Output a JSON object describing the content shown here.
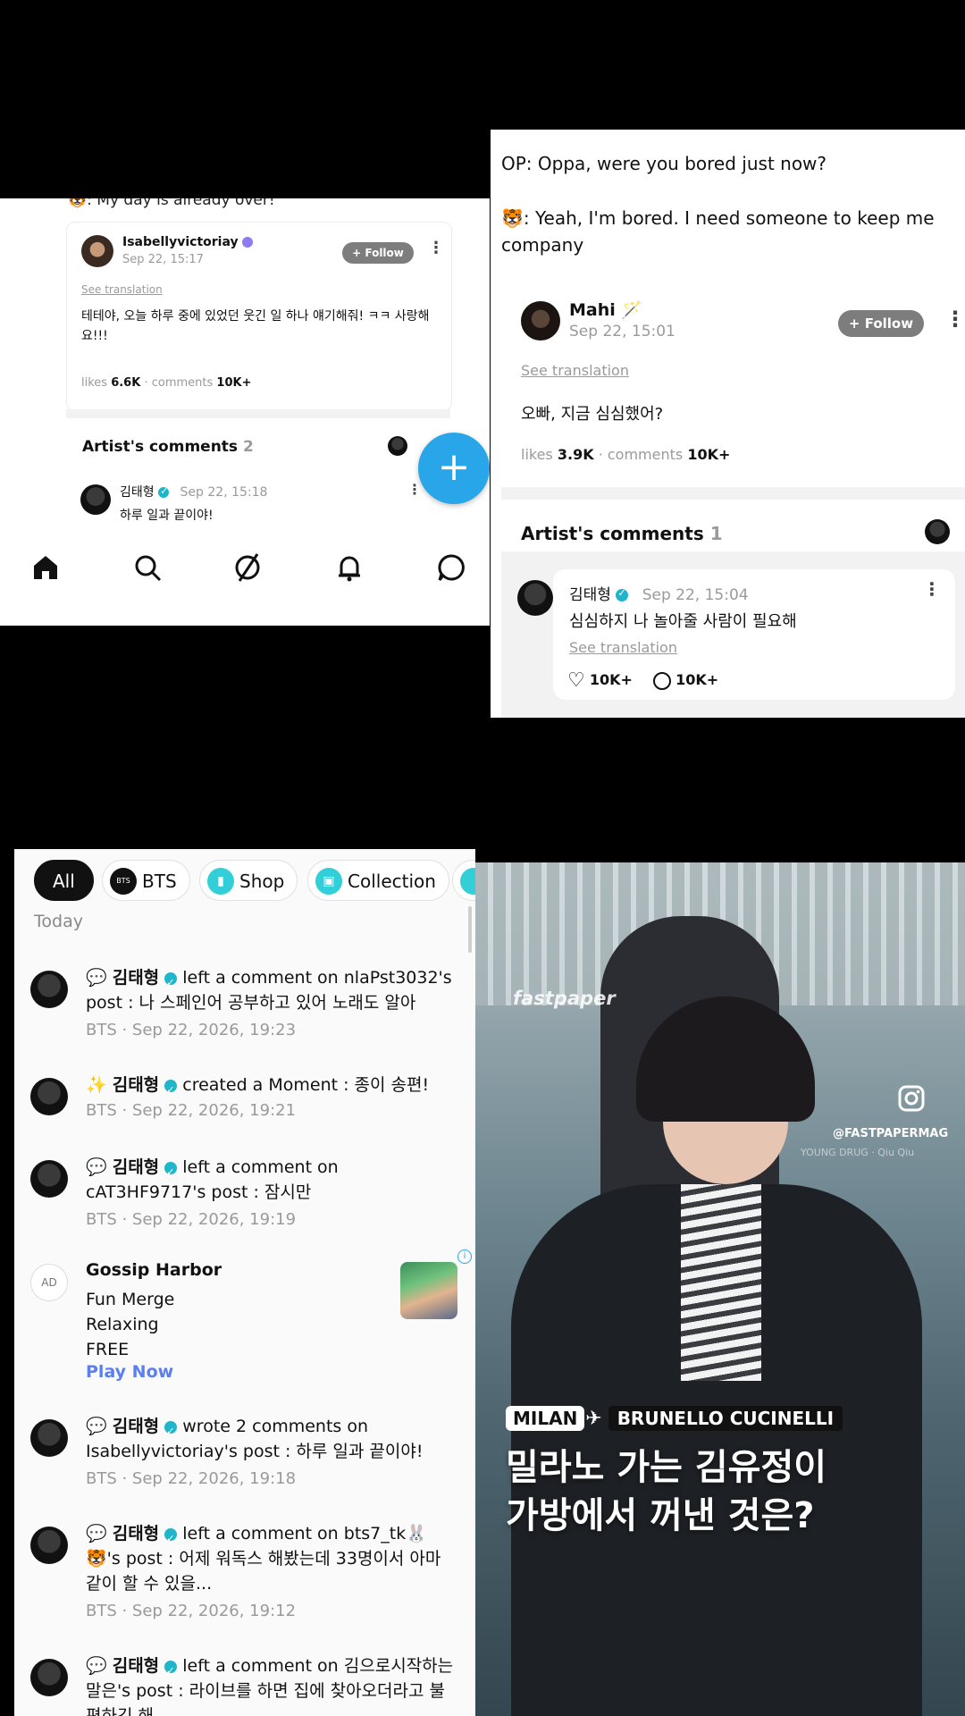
{
  "panel1": {
    "top_line": "🐯: My day is already over!",
    "post": {
      "author": "Isabellyvictoriay",
      "time": "Sep 22, 15:17",
      "follow": "+ Follow",
      "see_translation": "See translation",
      "body": "테테야, 오늘 하루 중에 있었던 웃긴 일 하나 얘기해줘! ㅋㅋ 사랑해요!!!",
      "likes_label": "likes",
      "likes": "6.6K",
      "comments_label": "· comments",
      "comments": "10K+"
    },
    "artist_comments": {
      "label": "Artist's comments",
      "count": "2"
    },
    "comment": {
      "author": "김태형",
      "time": "Sep 22, 15:18",
      "text": "하루 일과 끝이야!"
    },
    "fab": "+"
  },
  "panel2": {
    "op_line": "OP: Oppa, were you bored just now?",
    "reply_line": "🐯: Yeah, I'm bored. I need someone to keep me company",
    "post": {
      "author": "Mahi 🪄",
      "time": "Sep 22, 15:01",
      "follow": "+ Follow",
      "see_translation": "See translation",
      "body": "오빠, 지금 심심했어?",
      "likes_label": "likes",
      "likes": "3.9K",
      "comments_label": "· comments",
      "comments": "10K+"
    },
    "artist_comments": {
      "label": "Artist's comments",
      "count": "1"
    },
    "comment": {
      "author": "김태형",
      "time": "Sep 22, 15:04",
      "text": "심심하지 나 놀아줄 사람이 필요해",
      "see_translation": "See translation",
      "likes": "10K+",
      "comments": "10K+"
    }
  },
  "panel3": {
    "chips": [
      "All",
      "BTS",
      "Shop",
      "Collection"
    ],
    "chip_bts_icon_text": "BTS",
    "section": "Today",
    "items": [
      {
        "prefix": "💬",
        "name": "김태형",
        "text": " left a comment on nlaPst3032's post : 나 스페인어 공부하고 있어 노래도 알아",
        "meta": "BTS · Sep 22, 2026, 19:23"
      },
      {
        "prefix": "✨",
        "name": "김태형",
        "text": " created a Moment : 종이 송편!",
        "meta": "BTS · Sep 22, 2026, 19:21"
      },
      {
        "prefix": "💬",
        "name": "김태형",
        "text": " left a comment on cAT3HF9717's post : 잠시만",
        "meta": "BTS · Sep 22, 2026, 19:19"
      },
      {
        "prefix": "💬",
        "name": "김태형",
        "text": " wrote 2 comments on Isabellyvictoriay's post : 하루 일과 끝이야!",
        "meta": "BTS · Sep 22, 2026, 19:18"
      },
      {
        "prefix": "💬",
        "name": "김태형",
        "text": " left a comment on bts7_tk🐰🐯's post : 어제 워독스 해봤는데 33명이서 아마 같이 할 수 있을...",
        "meta": "BTS · Sep 22, 2026, 19:12"
      },
      {
        "prefix": "💬",
        "name": "김태형",
        "text": " left a comment on 김으로시작하는말은's post : 라이브를 하면 집에 찾아오더라고 불편하긴 해",
        "meta": ""
      }
    ],
    "ad": {
      "badge": "AD",
      "title": "Gossip Harbor",
      "lines": [
        "Fun Merge",
        "Relaxing",
        "FREE"
      ],
      "cta": "Play Now",
      "info": "i"
    }
  },
  "panel4": {
    "watermark": "fastpaper",
    "handle": "@FASTPAPERMAG",
    "credit": "YOUNG DRUG · Qiu Qiu",
    "tag_city": "MILAN",
    "tag_brand": "BRUNELLO CUCINELLI",
    "headline_1": "밀라노 가는 김유정이",
    "headline_2": "가방에서 꺼낸 것은?"
  }
}
